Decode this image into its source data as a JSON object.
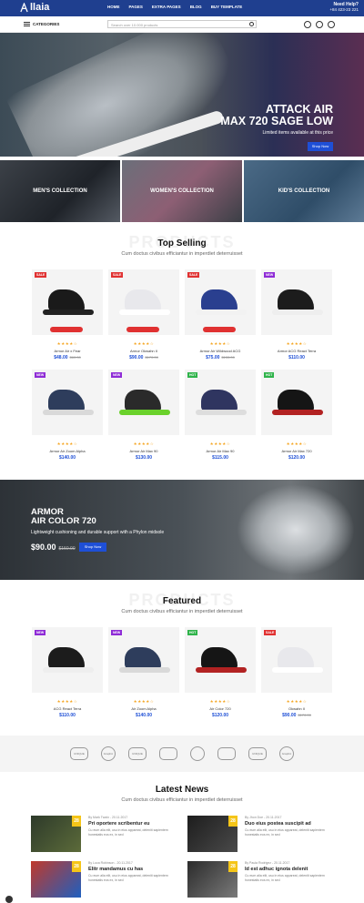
{
  "header": {
    "logo": "llaia",
    "nav": [
      "HOME",
      "PAGES",
      "EXTRA PAGES",
      "BLOG",
      "BUY TEMPLATE"
    ],
    "help_title": "Need Help?",
    "help_phone": "+84 423-23 221"
  },
  "searchbar": {
    "categories": "CATEGORIES",
    "placeholder": "Search over 10.000 products"
  },
  "hero": {
    "title1": "ATTACK AIR",
    "title2": "MAX 720 SAGE LOW",
    "subtitle": "Limited items available at this price",
    "button": "Shop Now"
  },
  "collections": [
    "MEN'S COLLECTION",
    "WOMEN'S COLLECTION",
    "KID'S COLLECTION"
  ],
  "top_selling": {
    "bg": "PRODUCTS",
    "title": "Top Selling",
    "subtitle": "Cum doctus civibus efficiantur in imperdiet deterruisset",
    "products": [
      {
        "badge": "SALE",
        "name": "Armor Air x Fear",
        "price": "$48.00",
        "old": "$60.00",
        "color": "#1a1a1a",
        "sole": "#222"
      },
      {
        "badge": "SALE",
        "name": "Armor Okwahn II",
        "price": "$90.00",
        "old": "$170.00",
        "color": "#e8e8ec",
        "sole": "#fff"
      },
      {
        "badge": "SALE",
        "name": "Armor Air Wildwood ACG",
        "price": "$75.00",
        "old": "$155.00",
        "color": "#2a3f8f",
        "sole": "#f2f2f2"
      },
      {
        "badge": "NEW",
        "name": "Armor ACG React Terra",
        "price": "$110.00",
        "old": "",
        "color": "#1c1c1c",
        "sole": "#eee"
      },
      {
        "badge": "NEW",
        "name": "Armor Air Zoom Alpha",
        "price": "$140.00",
        "old": "",
        "color": "#2e3d5c",
        "sole": "#d9d9d9"
      },
      {
        "badge": "NEW",
        "name": "Armor Air Max 90",
        "price": "$130.00",
        "old": "",
        "color": "#2a2a2a",
        "sole": "#6ad12b"
      },
      {
        "badge": "HOT",
        "name": "Armor Air Max 90",
        "price": "$115.00",
        "old": "",
        "color": "#2f3560",
        "sole": "#ddd"
      },
      {
        "badge": "HOT",
        "name": "Armor Air Max 720",
        "price": "$120.00",
        "old": "",
        "color": "#151515",
        "sole": "#b22222"
      }
    ]
  },
  "banner": {
    "title1": "ARMOR",
    "title2": "AIR COLOR 720",
    "subtitle": "Lightweight cushioning and durable support with a Phylon midsole",
    "price": "$90.00",
    "old": "$150.00",
    "button": "Shop Now"
  },
  "featured": {
    "bg": "PRODUCTS",
    "title": "Featured",
    "subtitle": "Cum doctus civibus efficiantur in imperdiet deterruisset",
    "products": [
      {
        "badge": "NEW",
        "name": "ACG React Terra",
        "price": "$110.00",
        "old": "",
        "color": "#1c1c1c",
        "sole": "#eee"
      },
      {
        "badge": "NEW",
        "name": "Air Zoom Alpha",
        "price": "$140.00",
        "old": "",
        "color": "#2e3d5c",
        "sole": "#d9d9d9"
      },
      {
        "badge": "HOT",
        "name": "Air Color 720",
        "price": "$120.00",
        "old": "",
        "color": "#151515",
        "sole": "#b22222"
      },
      {
        "badge": "SALE",
        "name": "Okwahn II",
        "price": "$90.00",
        "old": "$170.00",
        "color": "#e8e8ec",
        "sole": "#fff"
      }
    ]
  },
  "brands": [
    "UNIQUE",
    "Graphic",
    "UNIQUE",
    "",
    "",
    "",
    "UNIQUE",
    "Graphic"
  ],
  "news": {
    "title": "Latest News",
    "subtitle": "Cum doctus civibus efficiantur in imperdiet deterruisset",
    "items": [
      {
        "day": "28",
        "meta": "By Mark Twain - 20.11.2017",
        "title": "Pri oportere scribentur eu",
        "excerpt": "Cu eum alia elit, usu in eius appareat, deleniti sapientem honestatis eos ex, in sed",
        "c1": "#2d3a2a",
        "c2": "#5c6b3a"
      },
      {
        "day": "28",
        "meta": "By Jhon Doe - 20.11.2017",
        "title": "Duo eius postea suscipit ad",
        "excerpt": "Cu eum alia elit, usu in eius appareat, deleniti sapientem honestatis eos ex, in sed",
        "c1": "#1d1d1d",
        "c2": "#4a4a4a"
      },
      {
        "day": "28",
        "meta": "By Luca Robinson - 20.11.2017",
        "title": "Elitr mandamus cu has",
        "excerpt": "Cu eum alia elit, usu in eius appareat, deleniti sapientem honestatis eos ex, in sed",
        "c1": "#c0392b",
        "c2": "#1f5fbf"
      },
      {
        "day": "28",
        "meta": "By Paula Rodrigez - 20.11.2017",
        "title": "Id est adhuc ignota delenit",
        "excerpt": "Cu eum alia elit, usu in eius appareat, deleniti sapientem honestatis eos ex, in sed",
        "c1": "#2b2b2b",
        "c2": "#7a7a7a"
      }
    ]
  }
}
